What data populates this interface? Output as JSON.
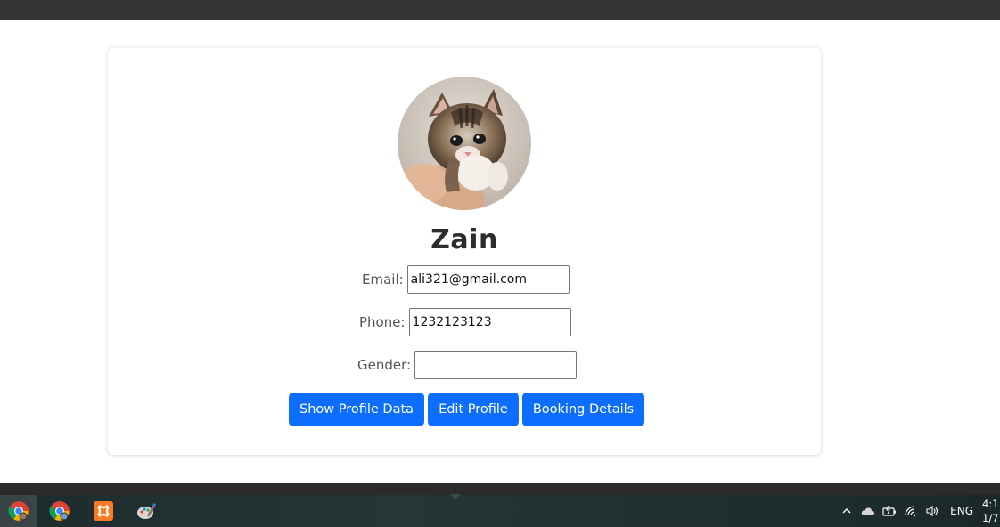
{
  "profile": {
    "name": "Zain",
    "avatar_alt": "kitten-photo"
  },
  "fields": {
    "email_label": "Email:",
    "email_value": "ali321@gmail.com",
    "phone_label": "Phone:",
    "phone_value": "1232123123",
    "gender_label": "Gender:",
    "gender_value": ""
  },
  "buttons": {
    "show_profile": "Show Profile Data",
    "edit_profile": "Edit Profile",
    "booking_details": "Booking Details"
  },
  "colors": {
    "primary_button": "#0d6efd",
    "top_bar": "#343434",
    "taskbar": "#1f2f30"
  },
  "taskbar": {
    "apps": [
      {
        "icon": "chrome-icon",
        "active": true
      },
      {
        "icon": "chrome-icon",
        "active": false
      },
      {
        "icon": "xampp-icon",
        "active": false
      },
      {
        "icon": "paint-icon",
        "active": false
      }
    ],
    "tray": {
      "icons": [
        "chevron-up-icon",
        "onedrive-cloud-icon",
        "battery-icon",
        "wifi-icon",
        "volume-icon"
      ],
      "language": "ENG",
      "time": "4:1",
      "date": "1/7"
    }
  }
}
